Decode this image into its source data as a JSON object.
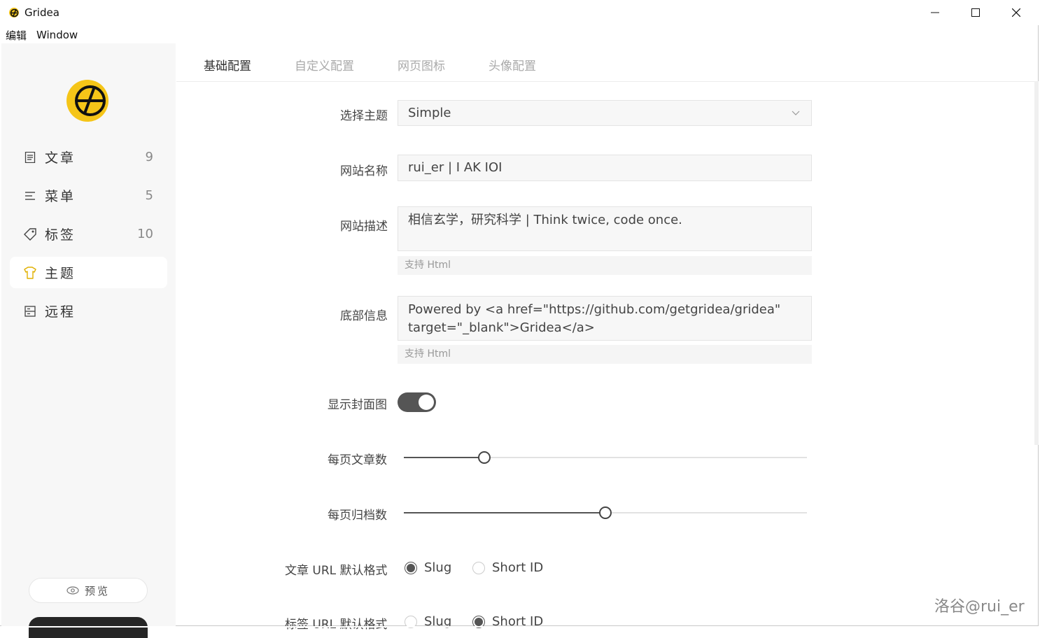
{
  "window": {
    "title": "Gridea"
  },
  "menubar": {
    "items": [
      "编辑",
      "Window"
    ]
  },
  "sidebar": {
    "items": [
      {
        "label": "文章",
        "count": "9",
        "icon": "article-icon"
      },
      {
        "label": "菜单",
        "count": "5",
        "icon": "menu-icon"
      },
      {
        "label": "标签",
        "count": "10",
        "icon": "tag-icon"
      },
      {
        "label": "主题",
        "count": "",
        "icon": "tshirt-icon",
        "active": true
      },
      {
        "label": "远程",
        "count": "",
        "icon": "remote-icon"
      }
    ],
    "preview_label": "预览"
  },
  "tabs": [
    "基础配置",
    "自定义配置",
    "网页图标",
    "头像配置"
  ],
  "form": {
    "theme": {
      "label": "选择主题",
      "value": "Simple"
    },
    "site_name": {
      "label": "网站名称",
      "value": "rui_er | I AK IOI"
    },
    "site_desc": {
      "label": "网站描述",
      "value": "相信玄学，研究科学 | Think twice, code once.",
      "hint": "支持 Html"
    },
    "footer": {
      "label": "底部信息",
      "value_line1": "Powered by <a href=\"https://github.com/getgridea/gridea\"",
      "value_line2": "target=\"_blank\">Gridea</a>",
      "hint": "支持 Html"
    },
    "show_cover": {
      "label": "显示封面图",
      "on": true
    },
    "posts_per_page": {
      "label": "每页文章数",
      "fraction": 0.2
    },
    "archives_per_page": {
      "label": "每页归档数",
      "fraction": 0.5
    },
    "post_url": {
      "label": "文章 URL 默认格式",
      "options": [
        "Slug",
        "Short ID"
      ],
      "selected": "Slug"
    },
    "tag_url": {
      "label": "标签 URL 默认格式",
      "options": [
        "Slug",
        "Short ID"
      ],
      "selected": "Short ID"
    }
  },
  "watermark": "洛谷@rui_er",
  "colors": {
    "accent": "#555555",
    "logo_yellow": "#f5c518",
    "sidebar_bg": "#f7f7f7"
  }
}
